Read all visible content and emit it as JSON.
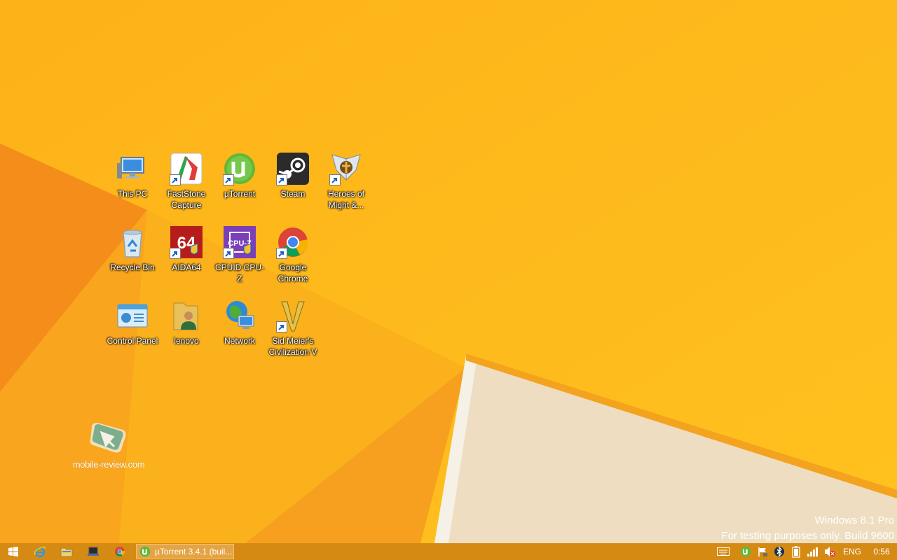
{
  "desktop": {
    "icons": [
      {
        "label": "This PC"
      },
      {
        "label": "FastStone Capture"
      },
      {
        "label": "µTorrent"
      },
      {
        "label": "Steam"
      },
      {
        "label": "Heroes of Might &..."
      },
      {
        "label": "Recycle Bin"
      },
      {
        "label": "AIDA64"
      },
      {
        "label": "CPUID CPU-Z"
      },
      {
        "label": "Google Chrome"
      },
      {
        "label": "Control Panel"
      },
      {
        "label": "lenovo"
      },
      {
        "label": "Network"
      },
      {
        "label": "Sid Meier's Civilization V"
      }
    ],
    "watermark": "mobile-review.com",
    "build_info": {
      "edition": "Windows 8.1 Pro",
      "note": "For testing purposes only. Build 9600"
    }
  },
  "taskbar": {
    "running_task": "µTorrent 3.4.1  (buil...",
    "tray": {
      "language": "ENG",
      "time": "0:56"
    }
  },
  "colors": {
    "wallpaper": "#fdbb1a",
    "taskbar": "#d58a14"
  }
}
